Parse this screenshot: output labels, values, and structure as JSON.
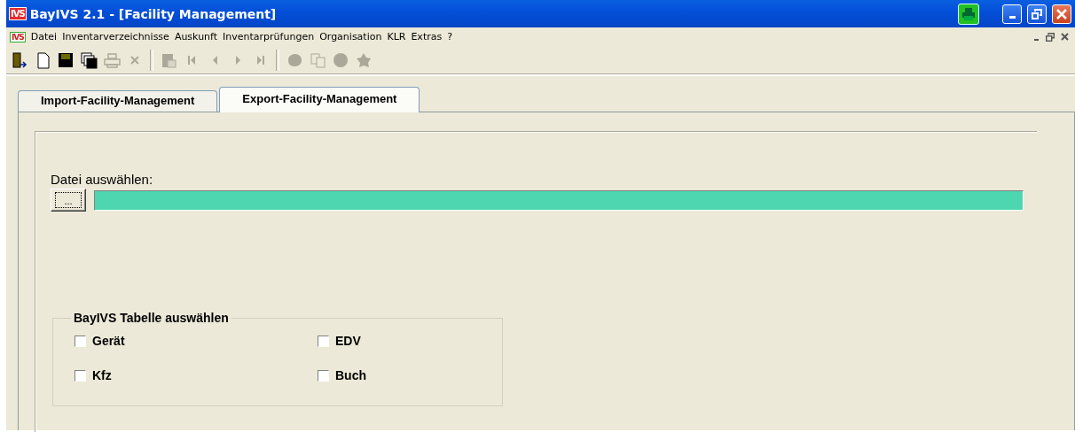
{
  "window": {
    "logo": "IVS",
    "title": "BayIVS 2.1 - [Facility Management]"
  },
  "menu": {
    "logo": "IVS",
    "items": [
      "Datei",
      "Inventarverzeichnisse",
      "Auskunft",
      "Inventarprüfungen",
      "Organisation",
      "KLR",
      "Extras",
      "?"
    ]
  },
  "toolbar": [
    {
      "kind": "exit",
      "disabled": false
    },
    {
      "kind": "new",
      "disabled": false
    },
    {
      "kind": "save",
      "disabled": false
    },
    {
      "kind": "saveall",
      "disabled": false
    },
    {
      "kind": "print",
      "disabled": true
    },
    {
      "kind": "delete",
      "disabled": true
    },
    {
      "kind": "sep"
    },
    {
      "kind": "paste",
      "disabled": true
    },
    {
      "kind": "first",
      "disabled": true
    },
    {
      "kind": "prev",
      "disabled": true
    },
    {
      "kind": "next",
      "disabled": true
    },
    {
      "kind": "last",
      "disabled": true
    },
    {
      "kind": "sep"
    },
    {
      "kind": "blob",
      "disabled": true
    },
    {
      "kind": "copy",
      "disabled": true
    },
    {
      "kind": "circle",
      "disabled": true
    },
    {
      "kind": "star",
      "disabled": true
    }
  ],
  "tabs": [
    {
      "label": "Import-Facility-Management",
      "selected": false
    },
    {
      "label": "Export-Facility-Management",
      "selected": true
    }
  ],
  "file": {
    "label": "Datei auswählen:",
    "browse": "..."
  },
  "group": {
    "title": "BayIVS Tabelle auswählen",
    "checkboxes": [
      {
        "label": "Gerät",
        "checked": false
      },
      {
        "label": "EDV",
        "checked": false
      },
      {
        "label": "Kfz",
        "checked": false
      },
      {
        "label": "Buch",
        "checked": false
      }
    ]
  }
}
